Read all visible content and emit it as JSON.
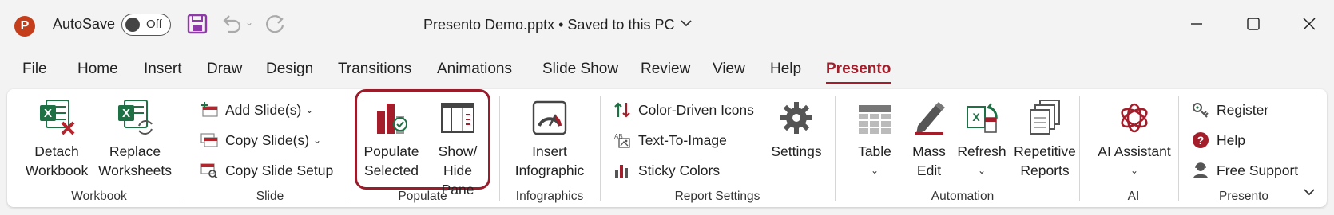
{
  "titlebar": {
    "app_icon_letter": "P",
    "autosave_label": "AutoSave",
    "autosave_state": "Off",
    "document_title": "Presento Demo.pptx • Saved to this PC"
  },
  "tabs": [
    {
      "label": "File"
    },
    {
      "label": "Home"
    },
    {
      "label": "Insert"
    },
    {
      "label": "Draw"
    },
    {
      "label": "Design"
    },
    {
      "label": "Transitions"
    },
    {
      "label": "Animations"
    },
    {
      "label": "Slide Show"
    },
    {
      "label": "Review"
    },
    {
      "label": "View"
    },
    {
      "label": "Help"
    },
    {
      "label": "Presento",
      "active": true
    }
  ],
  "ribbon": {
    "workbook": {
      "group_label": "Workbook",
      "detach": [
        "Detach",
        "Workbook"
      ],
      "replace": [
        "Replace",
        "Worksheets"
      ]
    },
    "slide": {
      "group_label": "Slide",
      "add_slide": "Add Slide(s)",
      "copy_slide": "Copy Slide(s)",
      "copy_setup": "Copy Slide Setup"
    },
    "populate": {
      "group_label": "Populate",
      "populate_selected": [
        "Populate",
        "Selected"
      ],
      "show_hide": [
        "Show/",
        "Hide Pane"
      ]
    },
    "infographics": {
      "group_label": "Infographics",
      "insert": [
        "Insert",
        "Infographic"
      ]
    },
    "report_settings": {
      "group_label": "Report Settings",
      "color_driven": "Color-Driven Icons",
      "text_to_image": "Text-To-Image",
      "sticky_colors": "Sticky Colors",
      "settings": "Settings"
    },
    "automation": {
      "group_label": "Automation",
      "table": "Table",
      "mass_edit": [
        "Mass",
        "Edit"
      ],
      "refresh": "Refresh",
      "repetitive": [
        "Repetitive",
        "Reports"
      ]
    },
    "ai": {
      "group_label": "AI",
      "assistant": "AI Assistant"
    },
    "presento": {
      "group_label": "Presento",
      "register": "Register",
      "help": "Help",
      "free_support": "Free Support"
    }
  },
  "colors": {
    "accent": "#a31d2a",
    "excel_green": "#1e7145",
    "ribbon_bg": "#ffffff",
    "window_bg": "#f3f3f3"
  }
}
